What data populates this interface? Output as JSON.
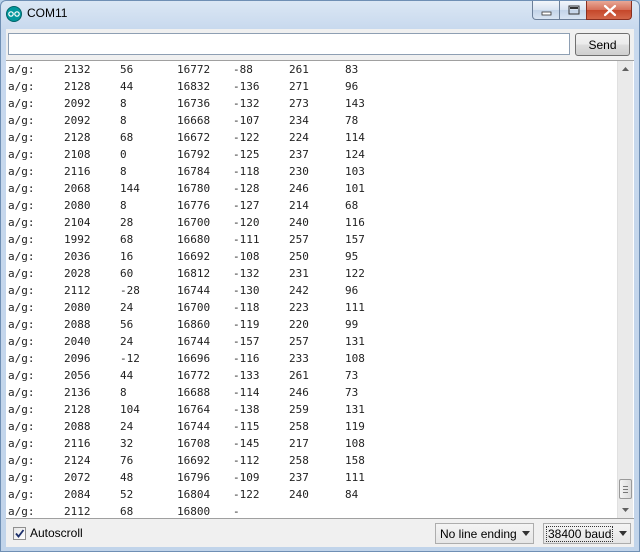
{
  "window": {
    "title": "COM11"
  },
  "send_bar": {
    "input_value": "",
    "send_label": "Send"
  },
  "serial_output": {
    "lines": [
      [
        "a/g:",
        "2132",
        "56",
        "16772",
        "-88",
        "261",
        "83"
      ],
      [
        "a/g:",
        "2128",
        "44",
        "16832",
        "-136",
        "271",
        "96"
      ],
      [
        "a/g:",
        "2092",
        "8",
        "16736",
        "-132",
        "273",
        "143"
      ],
      [
        "a/g:",
        "2092",
        "8",
        "16668",
        "-107",
        "234",
        "78"
      ],
      [
        "a/g:",
        "2128",
        "68",
        "16672",
        "-122",
        "224",
        "114"
      ],
      [
        "a/g:",
        "2108",
        "0",
        "16792",
        "-125",
        "237",
        "124"
      ],
      [
        "a/g:",
        "2116",
        "8",
        "16784",
        "-118",
        "230",
        "103"
      ],
      [
        "a/g:",
        "2068",
        "144",
        "16780",
        "-128",
        "246",
        "101"
      ],
      [
        "a/g:",
        "2080",
        "8",
        "16776",
        "-127",
        "214",
        "68"
      ],
      [
        "a/g:",
        "2104",
        "28",
        "16700",
        "-120",
        "240",
        "116"
      ],
      [
        "a/g:",
        "1992",
        "68",
        "16680",
        "-111",
        "257",
        "157"
      ],
      [
        "a/g:",
        "2036",
        "16",
        "16692",
        "-108",
        "250",
        "95"
      ],
      [
        "a/g:",
        "2028",
        "60",
        "16812",
        "-132",
        "231",
        "122"
      ],
      [
        "a/g:",
        "2112",
        "-28",
        "16744",
        "-130",
        "242",
        "96"
      ],
      [
        "a/g:",
        "2080",
        "24",
        "16700",
        "-118",
        "223",
        "111"
      ],
      [
        "a/g:",
        "2088",
        "56",
        "16860",
        "-119",
        "220",
        "99"
      ],
      [
        "a/g:",
        "2040",
        "24",
        "16744",
        "-157",
        "257",
        "131"
      ],
      [
        "a/g:",
        "2096",
        "-12",
        "16696",
        "-116",
        "233",
        "108"
      ],
      [
        "a/g:",
        "2056",
        "44",
        "16772",
        "-133",
        "261",
        "73"
      ],
      [
        "a/g:",
        "2136",
        "8",
        "16688",
        "-114",
        "246",
        "73"
      ],
      [
        "a/g:",
        "2128",
        "104",
        "16764",
        "-138",
        "259",
        "131"
      ],
      [
        "a/g:",
        "2088",
        "24",
        "16744",
        "-115",
        "258",
        "119"
      ],
      [
        "a/g:",
        "2116",
        "32",
        "16708",
        "-145",
        "217",
        "108"
      ],
      [
        "a/g:",
        "2124",
        "76",
        "16692",
        "-112",
        "258",
        "158"
      ],
      [
        "a/g:",
        "2072",
        "48",
        "16796",
        "-109",
        "237",
        "111"
      ],
      [
        "a/g:",
        "2084",
        "52",
        "16804",
        "-122",
        "240",
        "84"
      ],
      [
        "a/g:",
        "2112",
        "68",
        "16800",
        "-",
        "",
        ""
      ]
    ]
  },
  "bottom_bar": {
    "autoscroll_label": "Autoscroll",
    "autoscroll_checked": true,
    "line_ending_value": "No line ending",
    "baud_value": "38400 baud"
  },
  "icons": {
    "app": "arduino-logo-icon",
    "minimize": "minimize-icon",
    "maximize": "maximize-icon",
    "close": "close-icon",
    "scroll_up": "chevron-up-icon",
    "scroll_down": "chevron-down-icon",
    "dropdown": "chevron-down-icon",
    "checkbox": "checkmark-icon"
  },
  "colors": {
    "app_icon": "#00979c",
    "close_button": "#c5472a",
    "title_bar": "#c8d9ee"
  }
}
